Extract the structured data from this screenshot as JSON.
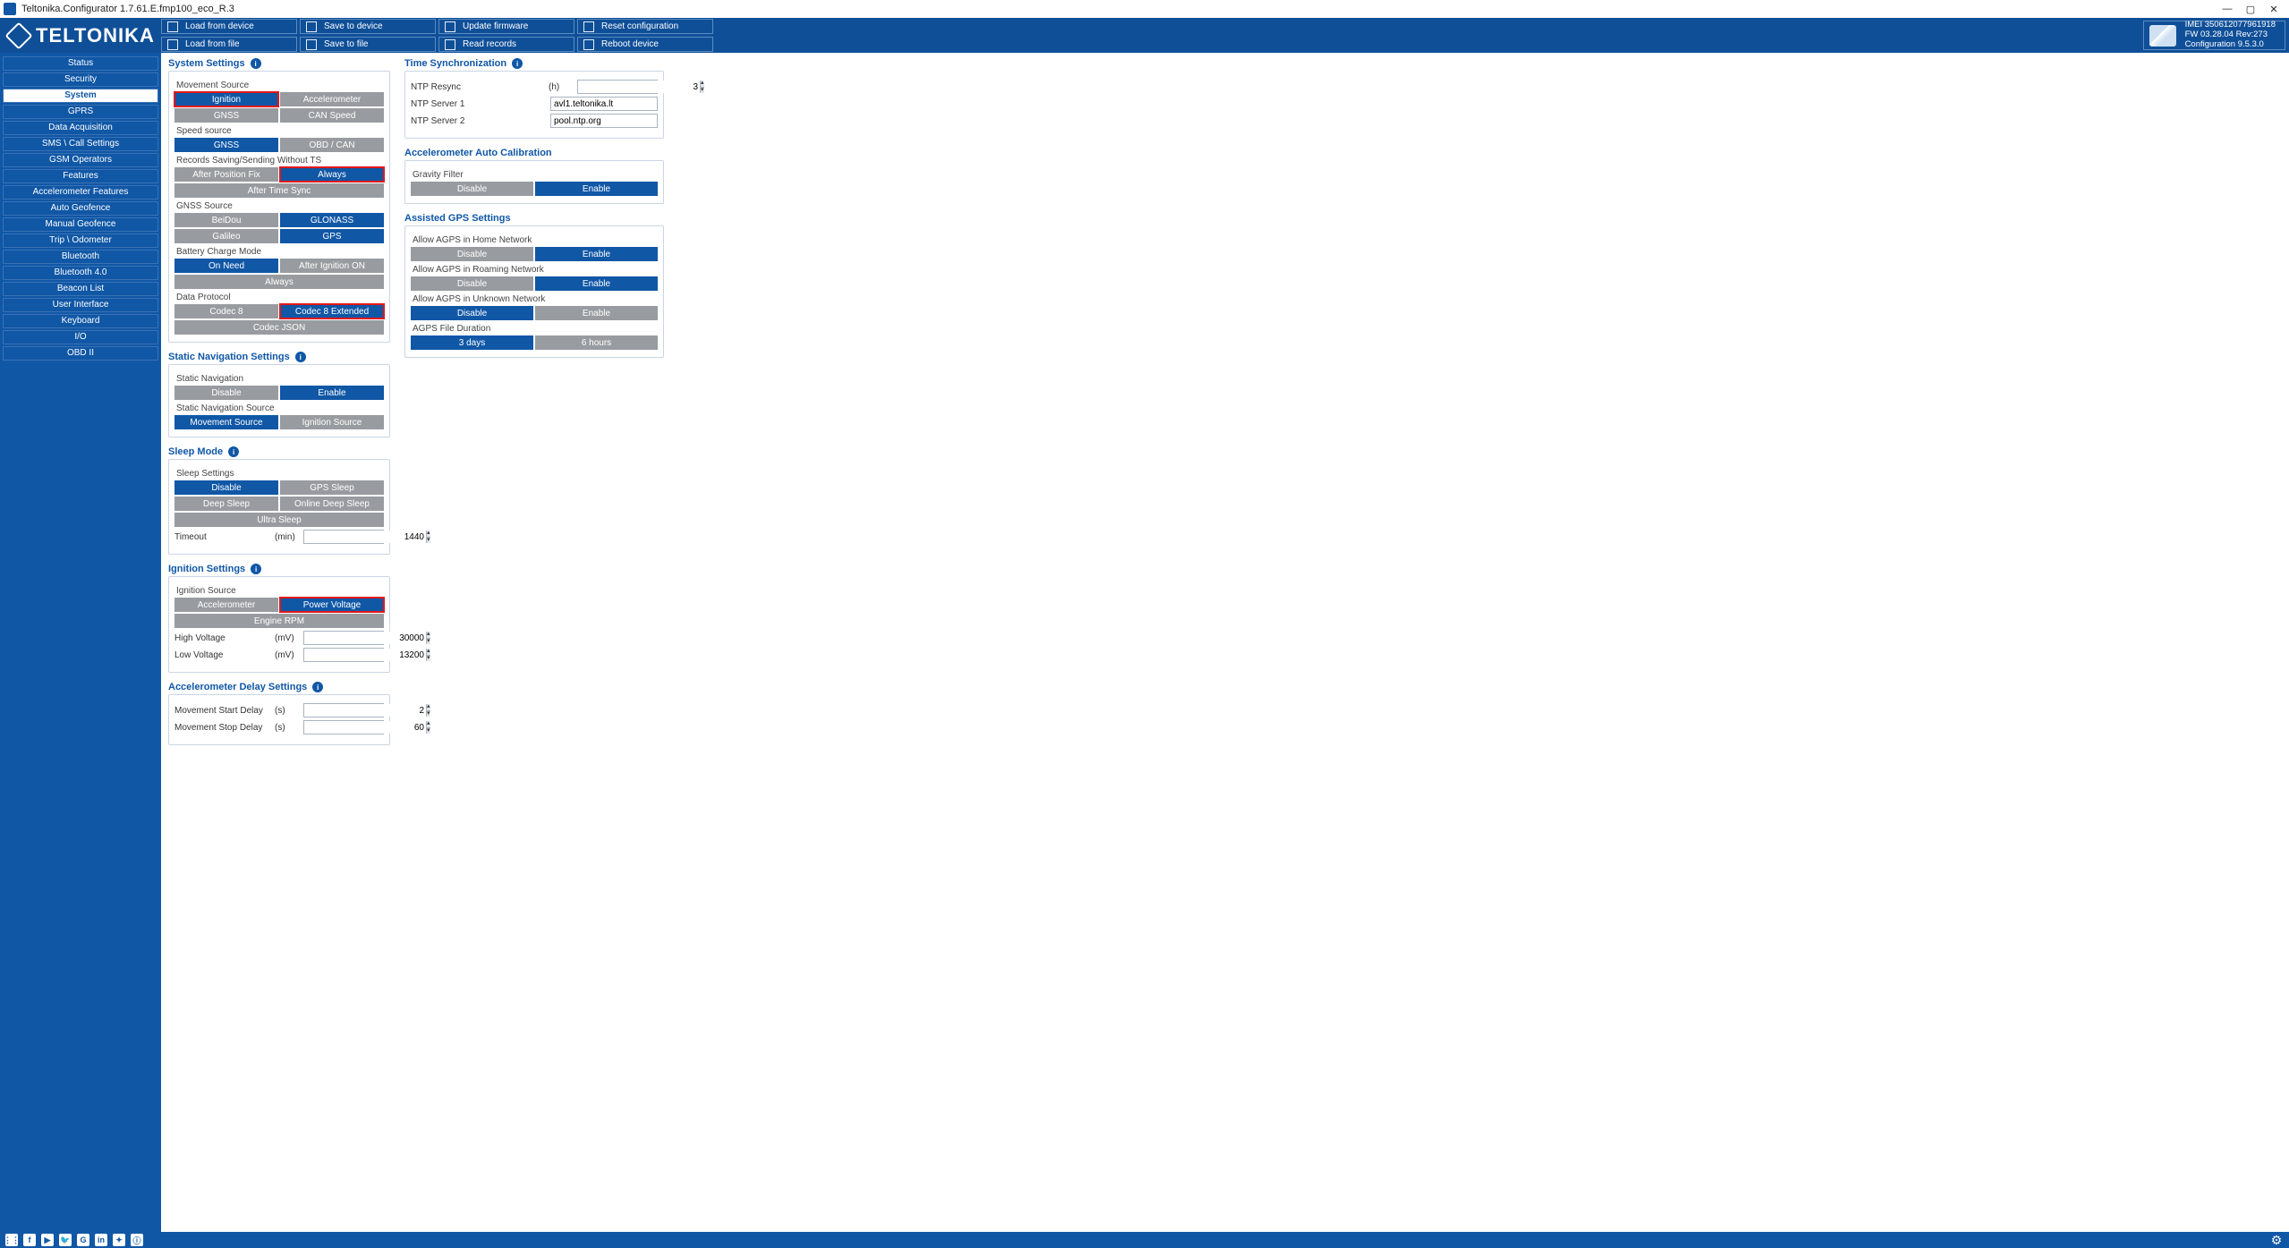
{
  "window": {
    "title": "Teltonika.Configurator 1.7.61.E.fmp100_eco_R.3"
  },
  "logo": "TELTONIKA",
  "toolbar": {
    "row1": [
      {
        "label": "Load from device"
      },
      {
        "label": "Save to device"
      },
      {
        "label": "Update firmware"
      },
      {
        "label": "Reset configuration"
      }
    ],
    "row2": [
      {
        "label": "Load from file"
      },
      {
        "label": "Save to file"
      },
      {
        "label": "Read records"
      },
      {
        "label": "Reboot device"
      }
    ]
  },
  "device": {
    "imei_label": "IMEI",
    "imei": "350612077961918",
    "fw_label": "FW",
    "fw": "03.28.04 Rev:273",
    "cfg_label": "Configuration",
    "cfg": "9.5.3.0"
  },
  "sidebar": [
    "Status",
    "Security",
    "System",
    "GPRS",
    "Data Acquisition",
    "SMS \\ Call Settings",
    "GSM Operators",
    "Features",
    "Accelerometer Features",
    "Auto Geofence",
    "Manual Geofence",
    "Trip \\ Odometer",
    "Bluetooth",
    "Bluetooth 4.0",
    "Beacon List",
    "User Interface",
    "Keyboard",
    "I/O",
    "OBD II"
  ],
  "sidebar_active": 2,
  "sysSettings": {
    "title": "System Settings",
    "movementSource": {
      "label": "Movement Source",
      "opts": [
        "Ignition",
        "Accelerometer",
        "GNSS",
        "CAN Speed"
      ],
      "selected": 0,
      "highlight": 0
    },
    "speedSource": {
      "label": "Speed source",
      "opts": [
        "GNSS",
        "OBD / CAN"
      ],
      "selected": 0
    },
    "recordsSaving": {
      "label": "Records Saving/Sending Without TS",
      "opts": [
        "After Position Fix",
        "Always",
        "After Time Sync"
      ],
      "selected": 1,
      "highlight": 1
    },
    "gnssSource": {
      "label": "GNSS Source",
      "opts": [
        "BeiDou",
        "GLONASS",
        "Galileo",
        "GPS"
      ],
      "selected": [
        1,
        3
      ]
    },
    "batteryCharge": {
      "label": "Battery Charge Mode",
      "opts": [
        "On Need",
        "After Ignition ON",
        "Always"
      ],
      "selected": 0
    },
    "dataProtocol": {
      "label": "Data Protocol",
      "opts": [
        "Codec 8",
        "Codec 8 Extended",
        "Codec JSON"
      ],
      "selected": 1,
      "highlight": 1
    }
  },
  "staticNav": {
    "title": "Static Navigation Settings",
    "staticNav": {
      "label": "Static Navigation",
      "opts": [
        "Disable",
        "Enable"
      ],
      "selected": 1
    },
    "source": {
      "label": "Static Navigation Source",
      "opts": [
        "Movement Source",
        "Ignition Source"
      ],
      "selected": 0
    }
  },
  "sleep": {
    "title": "Sleep Mode",
    "settings": {
      "label": "Sleep Settings",
      "opts": [
        "Disable",
        "GPS Sleep",
        "Deep Sleep",
        "Online Deep Sleep",
        "Ultra Sleep"
      ],
      "selected": 0
    },
    "timeout": {
      "label": "Timeout",
      "unit": "(min)",
      "value": "1440"
    }
  },
  "ignition": {
    "title": "Ignition Settings",
    "source": {
      "label": "Ignition Source",
      "opts": [
        "Accelerometer",
        "Power Voltage",
        "Engine RPM"
      ],
      "selected": 1,
      "highlight": 1
    },
    "highV": {
      "label": "High Voltage",
      "unit": "(mV)",
      "value": "30000"
    },
    "lowV": {
      "label": "Low Voltage",
      "unit": "(mV)",
      "value": "13200"
    }
  },
  "accDelay": {
    "title": "Accelerometer Delay Settings",
    "start": {
      "label": "Movement Start Delay",
      "unit": "(s)",
      "value": "2"
    },
    "stop": {
      "label": "Movement Stop Delay",
      "unit": "(s)",
      "value": "60"
    }
  },
  "timeSync": {
    "title": "Time Synchronization",
    "resync": {
      "label": "NTP Resync",
      "unit": "(h)",
      "value": "3"
    },
    "s1": {
      "label": "NTP Server 1",
      "value": "avl1.teltonika.lt"
    },
    "s2": {
      "label": "NTP Server 2",
      "value": "pool.ntp.org"
    }
  },
  "autoCal": {
    "title": "Accelerometer Auto Calibration",
    "gravity": {
      "label": "Gravity Filter",
      "opts": [
        "Disable",
        "Enable"
      ],
      "selected": 1
    }
  },
  "agps": {
    "title": "Assisted GPS Settings",
    "home": {
      "label": "Allow AGPS in Home Network",
      "opts": [
        "Disable",
        "Enable"
      ],
      "selected": 1
    },
    "roam": {
      "label": "Allow AGPS in Roaming Network",
      "opts": [
        "Disable",
        "Enable"
      ],
      "selected": 1
    },
    "unknown": {
      "label": "Allow AGPS in Unknown Network",
      "opts": [
        "Disable",
        "Enable"
      ],
      "selected": 0
    },
    "dur": {
      "label": "AGPS File Duration",
      "opts": [
        "3 days",
        "6 hours"
      ],
      "selected": 0
    }
  },
  "footer_icons": [
    "⋮⋮",
    "f",
    "▶",
    "🐦",
    "G",
    "in",
    "✦",
    "ⓘ"
  ]
}
